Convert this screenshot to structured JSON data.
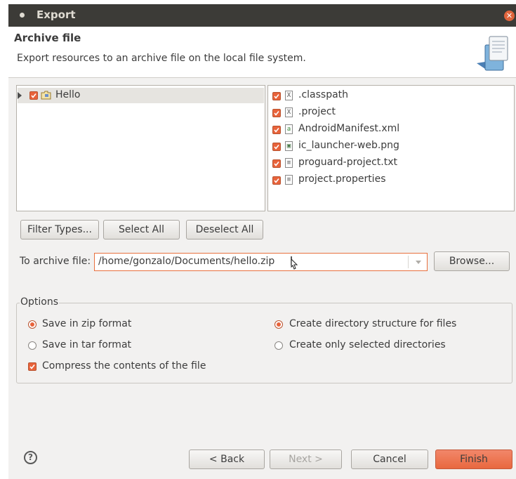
{
  "window": {
    "title": "Export"
  },
  "header": {
    "title": "Archive file",
    "description": "Export resources to an archive file on the local file system."
  },
  "tree": {
    "project": {
      "label": "Hello",
      "checked": true
    }
  },
  "files": [
    {
      "name": ".classpath",
      "icon": "xml-file-icon",
      "glyph": "X",
      "checked": true
    },
    {
      "name": ".project",
      "icon": "xml-file-icon",
      "glyph": "X",
      "checked": true
    },
    {
      "name": "AndroidManifest.xml",
      "icon": "android-manifest-icon",
      "glyph": "a",
      "checked": true
    },
    {
      "name": "ic_launcher-web.png",
      "icon": "image-file-icon",
      "glyph": "▣",
      "checked": true
    },
    {
      "name": "proguard-project.txt",
      "icon": "text-file-icon",
      "glyph": "≡",
      "checked": true
    },
    {
      "name": "project.properties",
      "icon": "text-file-icon",
      "glyph": "≡",
      "checked": true
    }
  ],
  "buttons": {
    "filter_types": "Filter Types...",
    "select_all": "Select All",
    "deselect_all": "Deselect All",
    "browse": "Browse...",
    "back": "< Back",
    "next": "Next >",
    "cancel": "Cancel",
    "finish": "Finish"
  },
  "archive": {
    "label": "To archive file:",
    "value": "/home/gonzalo/Documents/hello.zip"
  },
  "options": {
    "legend": "Options",
    "zip": {
      "label": "Save in zip format",
      "selected": true
    },
    "tar": {
      "label": "Save in tar format",
      "selected": false
    },
    "compress": {
      "label": "Compress the contents of the file",
      "checked": true
    },
    "create_structure": {
      "label": "Create directory structure for files",
      "selected": true
    },
    "create_selected": {
      "label": "Create only selected directories",
      "selected": false
    }
  },
  "colors": {
    "accent": "#e8633b",
    "titlebar": "#3c3b37"
  }
}
